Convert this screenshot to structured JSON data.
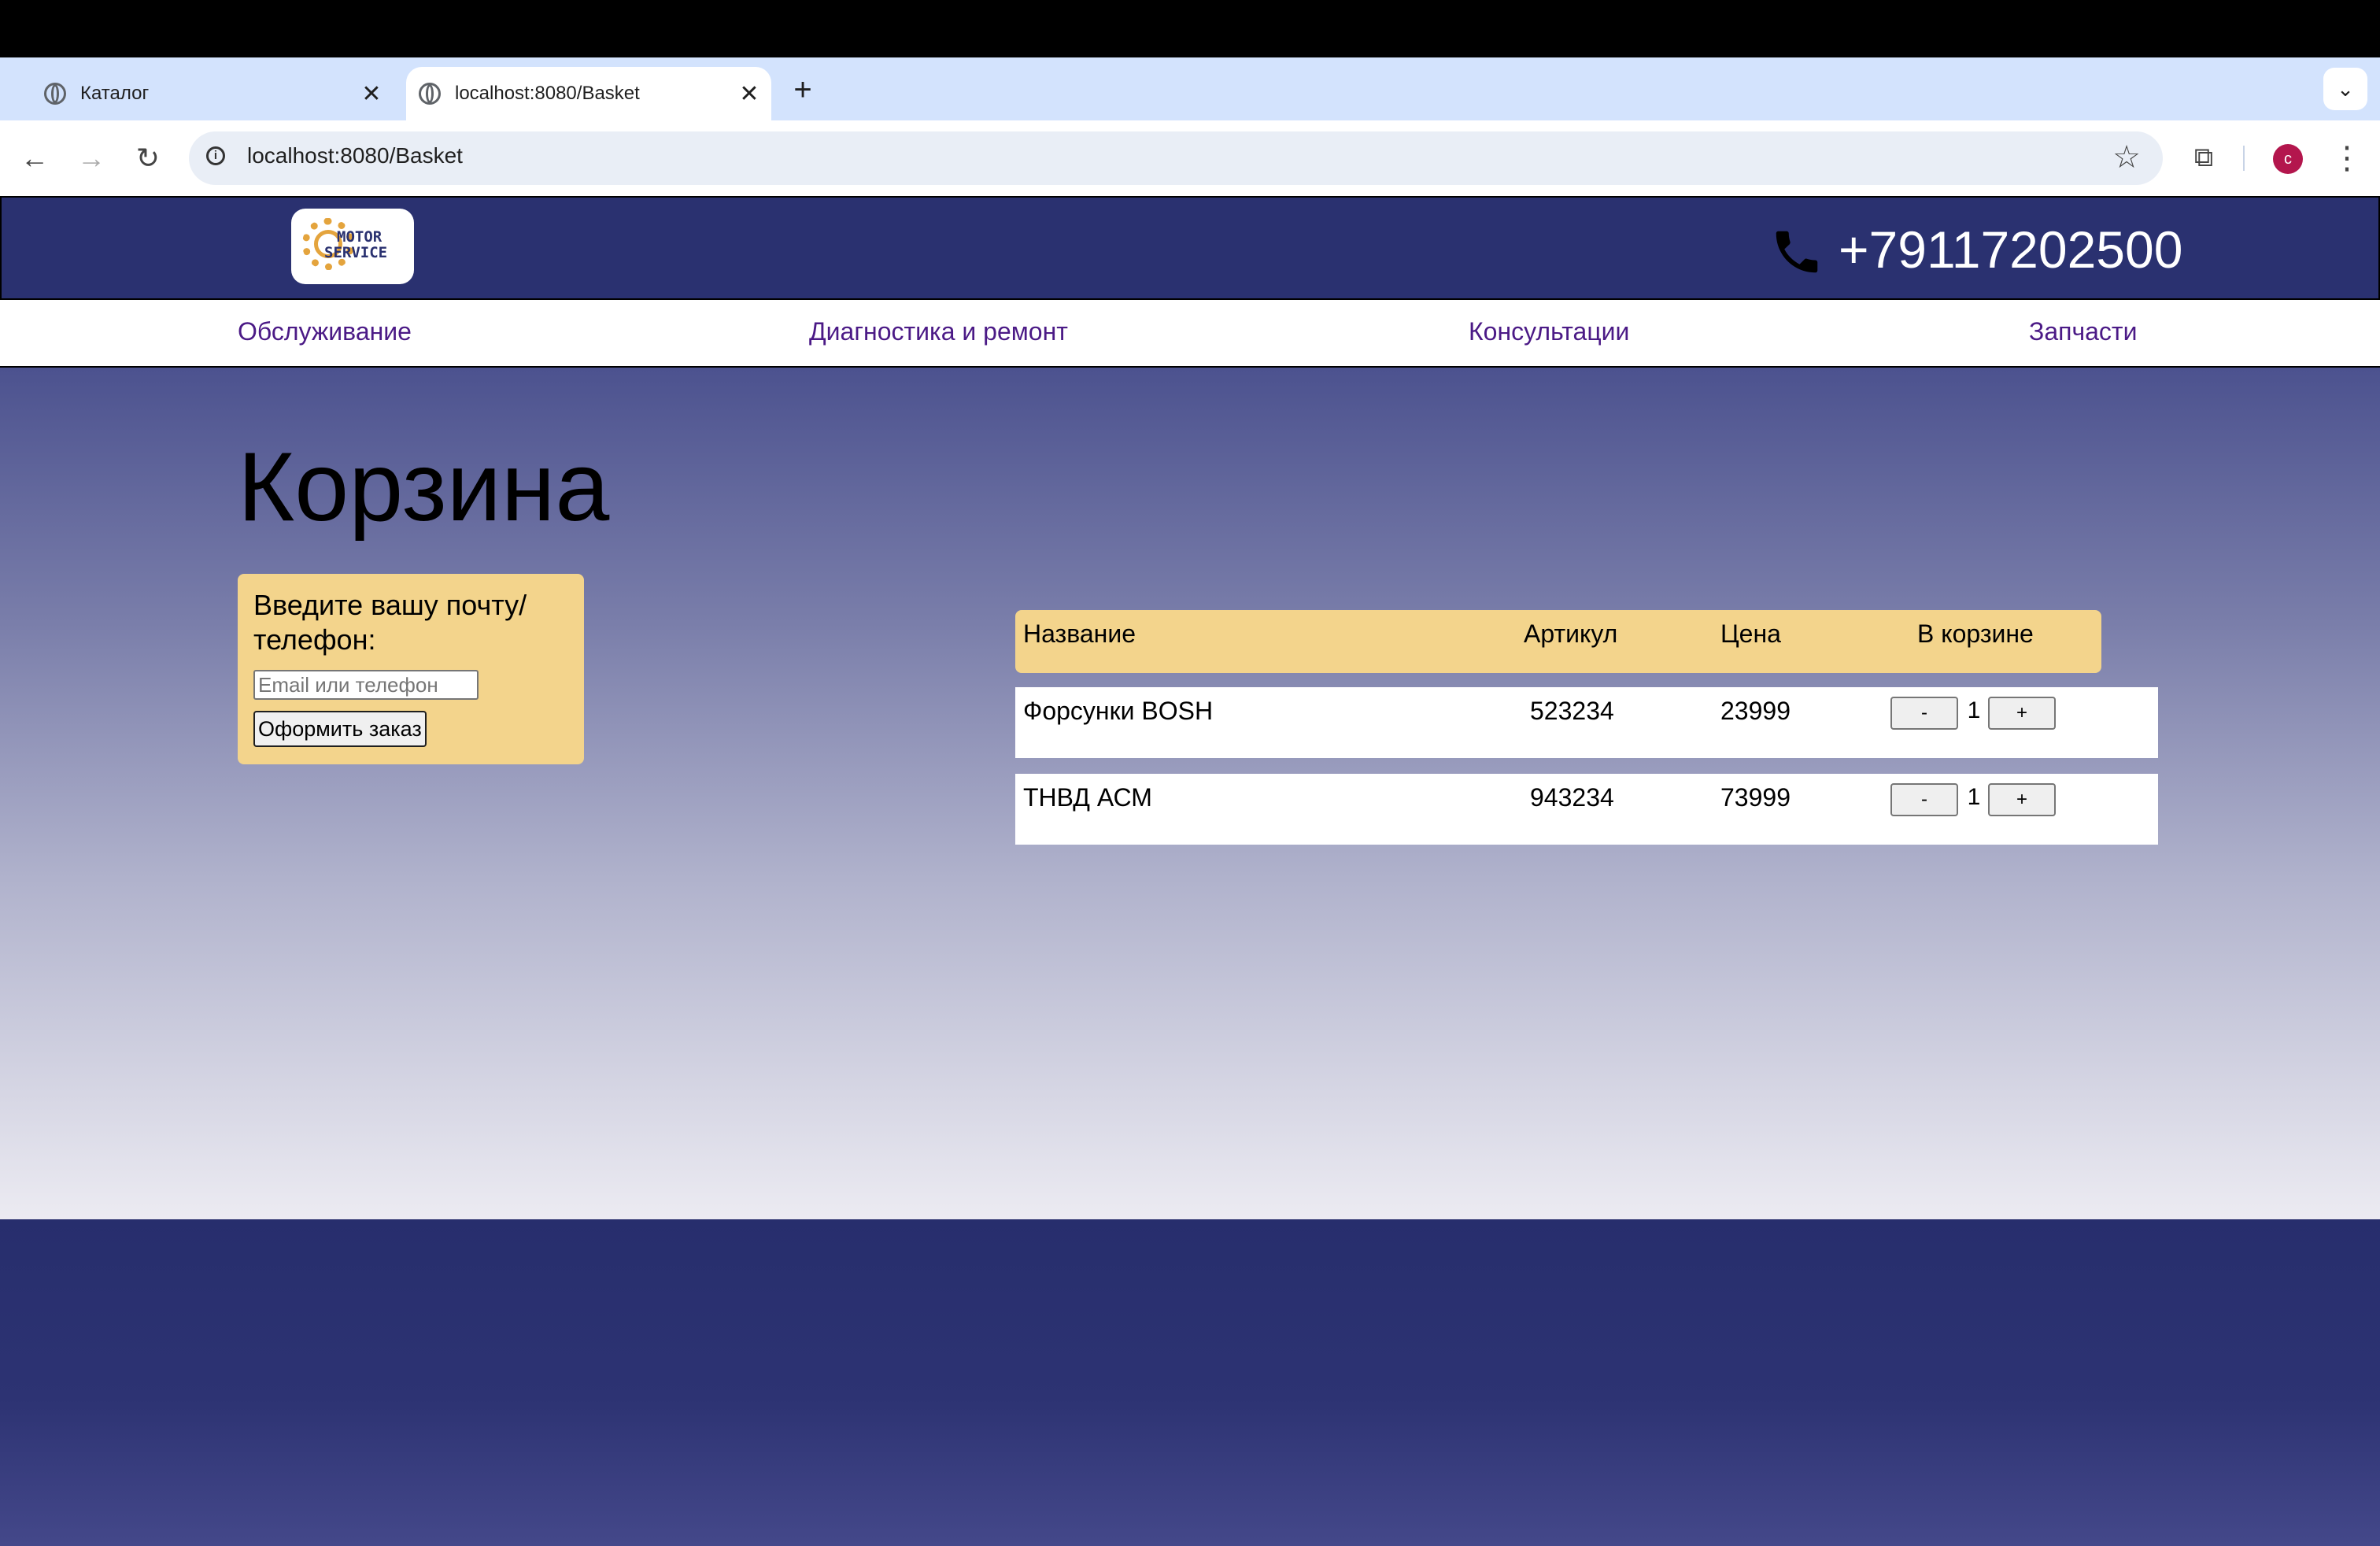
{
  "browser": {
    "tabs": [
      {
        "title": "Каталог",
        "active": false
      },
      {
        "title": "localhost:8080/Basket",
        "active": true
      }
    ],
    "address": "localhost:8080/Basket",
    "profile_initial": "c"
  },
  "header": {
    "logo_line1": "MOTOR",
    "logo_line2": "SERVICE",
    "phone": "+79117202500"
  },
  "nav": {
    "items": [
      "Обслуживание",
      "Диагностика и ремонт",
      "Консультации",
      "Запчасти"
    ]
  },
  "basket": {
    "title": "Корзина",
    "order_form": {
      "label": "Введите вашу почту/ телефон:",
      "placeholder": "Email или телефон",
      "value": "",
      "submit_label": "Оформить заказ"
    },
    "columns": [
      "Название",
      "Артикул",
      "Цена",
      "В корзине"
    ],
    "rows": [
      {
        "name": "Форсунки BOSH",
        "sku": "523234",
        "price": "23999",
        "qty": "1"
      },
      {
        "name": "ТНВД АСМ",
        "sku": "943234",
        "price": "73999",
        "qty": "1"
      }
    ],
    "minus_label": "-",
    "plus_label": "+"
  }
}
